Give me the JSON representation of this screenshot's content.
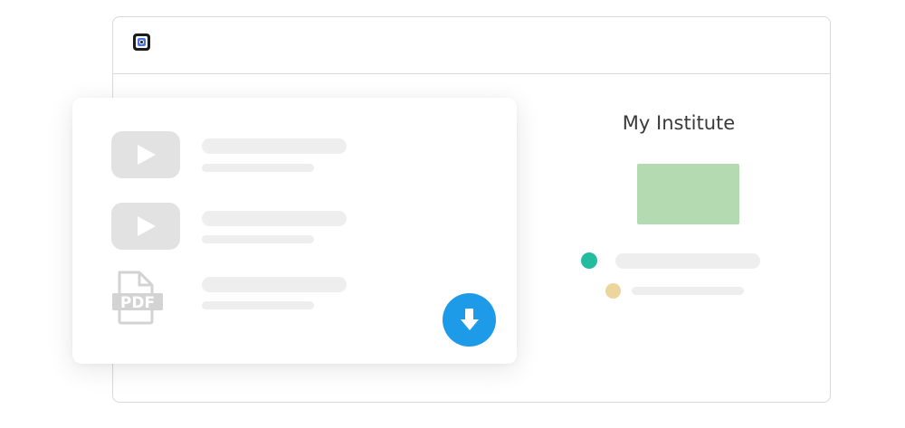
{
  "window": {
    "logo_icon": "app-logo-icon"
  },
  "institute": {
    "title": "My Institute",
    "accent_green": "#b3dab0",
    "dot_teal": "#22bd9e",
    "dot_yellow": "#ecd69c"
  },
  "card": {
    "items": [
      {
        "type": "video",
        "icon": "video-play-icon"
      },
      {
        "type": "video",
        "icon": "video-play-icon"
      },
      {
        "type": "pdf",
        "icon": "pdf-icon",
        "icon_label": "PDF"
      }
    ],
    "download_button": {
      "icon": "download-arrow-icon",
      "color": "#1e9be8"
    }
  }
}
